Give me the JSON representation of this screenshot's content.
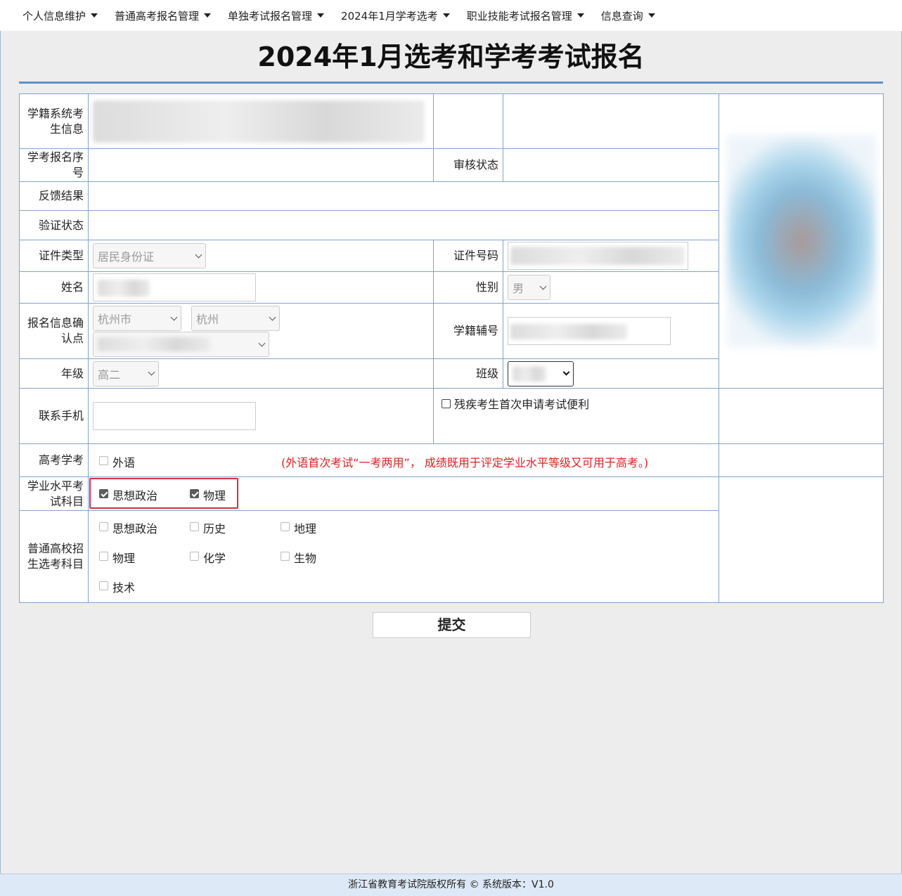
{
  "nav": [
    {
      "label": "个人信息维护"
    },
    {
      "label": "普通高考报名管理"
    },
    {
      "label": "单独考试报名管理"
    },
    {
      "label": "2024年1月学考选考"
    },
    {
      "label": "职业技能考试报名管理"
    },
    {
      "label": "信息查询"
    }
  ],
  "page_title": "2024年1月选考和学考考试报名",
  "form": {
    "xueji_label": "学籍系统考生信息",
    "baoming_no_label": "学考报名序号",
    "shenhe_label": "审核状态",
    "fankui_label": "反馈结果",
    "yanzheng_label": "验证状态",
    "id_type_label": "证件类型",
    "id_type_value": "居民身份证",
    "id_no_label": "证件号码",
    "name_label": "姓名",
    "gender_label": "性别",
    "gender_value": "男",
    "confirm_label": "报名信息确认点",
    "city_value": "杭州市",
    "district_value": "杭州",
    "xueji_fuhao_label": "学籍辅号",
    "grade_label": "年级",
    "grade_value": "高二",
    "class_label": "班级",
    "phone_label": "联系手机",
    "disabled_label": "残疾考生首次申请考试便利",
    "gaokao_label": "高考学考",
    "waiyu_label": "外语",
    "waiyu_note": "(外语首次考试“一考两用”， 成绩既用于评定学业水平等级又可用于高考。)",
    "xueye_label": "学业水平考试科目",
    "xueye_subjects": [
      "思想政治",
      "物理"
    ],
    "xuankao_label": "普通高校招生选考科目",
    "xuankao_subjects": [
      "思想政治",
      "历史",
      "地理",
      "物理",
      "化学",
      "生物",
      "技术"
    ],
    "submit_label": "提交"
  },
  "footer": "浙江省教育考试院版权所有 ©    系统版本：V1.0",
  "colors": {
    "accent": "#5b8fd1",
    "note": "#e02020",
    "highlight": "#d03040"
  }
}
